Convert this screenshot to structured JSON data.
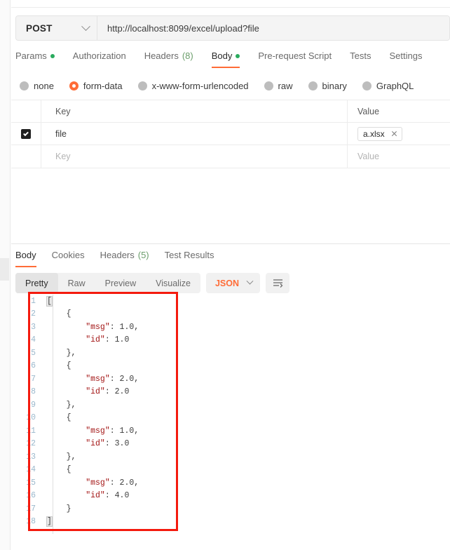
{
  "request": {
    "method": "POST",
    "url": "http://localhost:8099/excel/upload?file",
    "tabs": [
      {
        "label": "Params",
        "dot": true,
        "count": "",
        "active": false
      },
      {
        "label": "Authorization",
        "dot": false,
        "count": "",
        "active": false
      },
      {
        "label": "Headers",
        "dot": false,
        "count": "(8)",
        "active": false
      },
      {
        "label": "Body",
        "dot": true,
        "count": "",
        "active": true
      },
      {
        "label": "Pre-request Script",
        "dot": false,
        "count": "",
        "active": false
      },
      {
        "label": "Tests",
        "dot": false,
        "count": "",
        "active": false
      },
      {
        "label": "Settings",
        "dot": false,
        "count": "",
        "active": false
      }
    ],
    "body_types": [
      {
        "label": "none",
        "selected": false
      },
      {
        "label": "form-data",
        "selected": true
      },
      {
        "label": "x-www-form-urlencoded",
        "selected": false
      },
      {
        "label": "raw",
        "selected": false
      },
      {
        "label": "binary",
        "selected": false
      },
      {
        "label": "GraphQL",
        "selected": false
      }
    ],
    "form_data": {
      "headers": {
        "key": "Key",
        "value": "Value"
      },
      "rows": [
        {
          "checked": true,
          "key": "file",
          "value": "a.xlsx",
          "is_file": true,
          "key_placeholder": "",
          "value_placeholder": ""
        },
        {
          "checked": false,
          "key": "",
          "value": "",
          "is_file": false,
          "key_placeholder": "Key",
          "value_placeholder": "Value"
        }
      ]
    }
  },
  "response": {
    "tabs": [
      {
        "label": "Body",
        "count": "",
        "active": true
      },
      {
        "label": "Cookies",
        "count": "",
        "active": false
      },
      {
        "label": "Headers",
        "count": "(5)",
        "active": false
      },
      {
        "label": "Test Results",
        "count": "",
        "active": false
      }
    ],
    "view_modes": [
      {
        "label": "Pretty",
        "active": true
      },
      {
        "label": "Raw",
        "active": false
      },
      {
        "label": "Preview",
        "active": false
      },
      {
        "label": "Visualize",
        "active": false
      }
    ],
    "format": "JSON",
    "wrap_icon": "wrap-lines-icon",
    "body_lines": [
      {
        "n": "1",
        "code": "["
      },
      {
        "n": "2",
        "code": "    {"
      },
      {
        "n": "3",
        "code": "        \"msg\": 1.0,"
      },
      {
        "n": "4",
        "code": "        \"id\": 1.0"
      },
      {
        "n": "5",
        "code": "    },"
      },
      {
        "n": "6",
        "code": "    {"
      },
      {
        "n": "7",
        "code": "        \"msg\": 2.0,"
      },
      {
        "n": "8",
        "code": "        \"id\": 2.0"
      },
      {
        "n": "9",
        "code": "    },"
      },
      {
        "n": "10",
        "code": "    {"
      },
      {
        "n": "11",
        "code": "        \"msg\": 1.0,"
      },
      {
        "n": "12",
        "code": "        \"id\": 3.0"
      },
      {
        "n": "13",
        "code": "    },"
      },
      {
        "n": "14",
        "code": "    {"
      },
      {
        "n": "15",
        "code": "        \"msg\": 2.0,"
      },
      {
        "n": "16",
        "code": "        \"id\": 4.0"
      },
      {
        "n": "17",
        "code": "    }"
      },
      {
        "n": "18",
        "code": "]"
      }
    ],
    "body_json": [
      {
        "msg": 1.0,
        "id": 1.0
      },
      {
        "msg": 2.0,
        "id": 2.0
      },
      {
        "msg": 1.0,
        "id": 3.0
      },
      {
        "msg": 2.0,
        "id": 4.0
      }
    ]
  },
  "colors": {
    "accent": "#ff6c37",
    "dot_green": "#2aab5e",
    "highlight_box": "#f41a0e",
    "json_key": "#a31515",
    "json_value": "#1a9a9a",
    "line_number": "#9bb8cc"
  }
}
